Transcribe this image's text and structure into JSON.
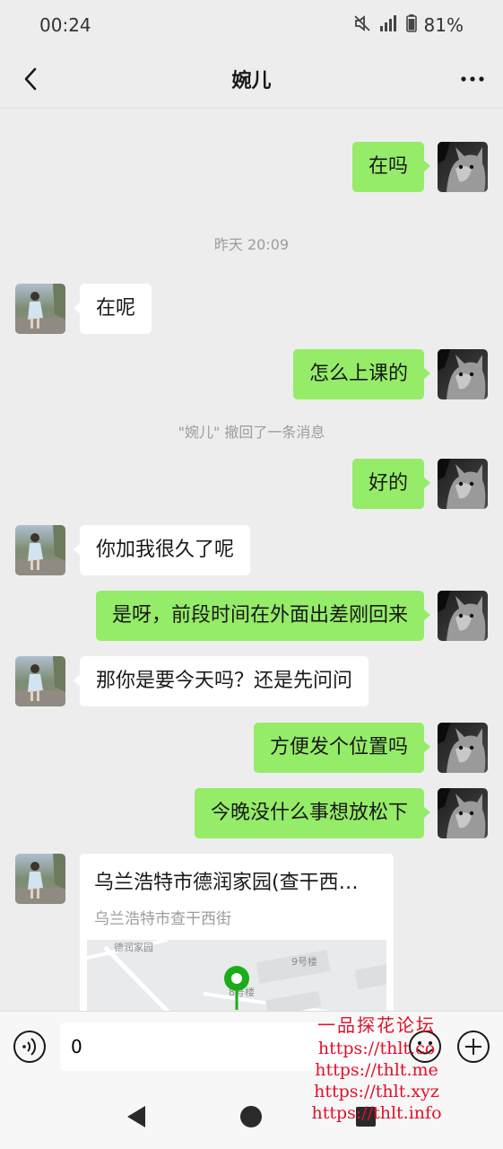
{
  "status_bar": {
    "time": "00:24",
    "battery": "81%"
  },
  "header": {
    "title": "婉儿"
  },
  "messages": [
    {
      "side": "right",
      "text": "在吗"
    },
    {
      "type": "system",
      "text": "昨天 20:09"
    },
    {
      "side": "left",
      "text": "在呢"
    },
    {
      "side": "right",
      "text": "怎么上课的"
    },
    {
      "type": "system",
      "text": "\"婉儿\" 撤回了一条消息"
    },
    {
      "side": "right",
      "text": "好的"
    },
    {
      "side": "left",
      "text": "你加我很久了呢"
    },
    {
      "side": "right",
      "text": "是呀，前段时间在外面出差刚回来"
    },
    {
      "side": "left",
      "text": "那你是要今天吗？还是先问问"
    },
    {
      "side": "right",
      "text": "方便发个位置吗"
    },
    {
      "side": "right",
      "text": "今晚没什么事想放松下"
    },
    {
      "side": "left",
      "type": "location",
      "title": "乌兰浩特市德润家园(查干西…",
      "address": "乌兰浩特市查干西街",
      "map_labels": [
        "德润家园",
        "9号楼",
        "8号楼"
      ]
    }
  ],
  "input_bar": {
    "value": "0"
  },
  "watermark": {
    "title": "一品探花论坛",
    "lines": [
      "https://thlt.co",
      "https://thlt.me",
      "https://thlt.xyz",
      "https://thlt.info"
    ]
  },
  "colors": {
    "background": "#ededed",
    "bubble_self": "#95ec69",
    "bubble_other": "#ffffff",
    "map_pin": "#1aad19",
    "watermark": "#e0112b"
  },
  "icons": [
    "back-arrow-icon",
    "more-icon",
    "mute-icon",
    "signal-icon",
    "battery-icon",
    "voice-icon",
    "emoji-icon",
    "plus-icon",
    "nav-back-icon",
    "nav-home-icon",
    "nav-recent-icon",
    "map-pin-icon"
  ]
}
